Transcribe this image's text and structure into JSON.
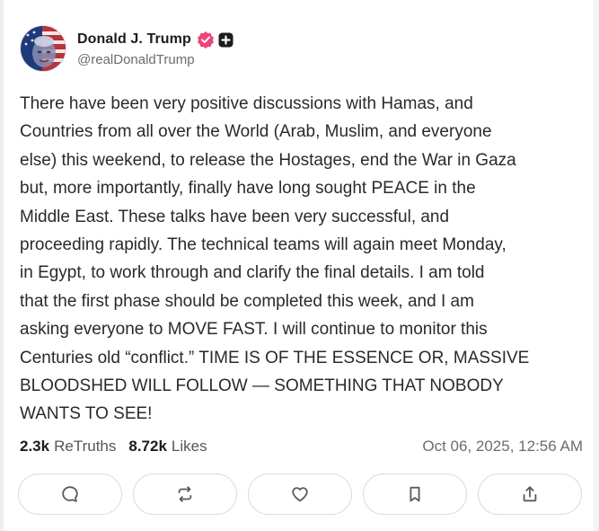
{
  "author": {
    "display_name": "Donald J. Trump",
    "handle": "@realDonaldTrump",
    "verified_color": "#f0447a"
  },
  "post": {
    "text": "There have been very positive discussions with Hamas, and\nCountries from all over the World (Arab, Muslim, and everyone\nelse) this weekend, to release the Hostages, end the War in Gaza\nbut, more importantly, finally have long sought PEACE in the\nMiddle East. These talks have been very successful, and\nproceeding rapidly. The technical teams will again meet Monday,\nin Egypt, to work through and clarify the final details. I am told\nthat the first phase should be completed this week, and I am\nasking everyone to MOVE FAST. I will continue to monitor this\nCenturies old “conflict.” TIME IS OF THE ESSENCE OR, MASSIVE\nBLOODSHED WILL FOLLOW — SOMETHING THAT NOBODY\nWANTS TO SEE!"
  },
  "stats": {
    "retruths_count": "2.3k",
    "retruths_label": "ReTruths",
    "likes_count": "8.72k",
    "likes_label": "Likes",
    "timestamp": "Oct 06, 2025, 12:56 AM"
  },
  "actions": [
    {
      "icon": "reply-icon"
    },
    {
      "icon": "retruth-icon"
    },
    {
      "icon": "like-heart-icon"
    },
    {
      "icon": "bookmark-icon"
    },
    {
      "icon": "share-icon"
    }
  ]
}
